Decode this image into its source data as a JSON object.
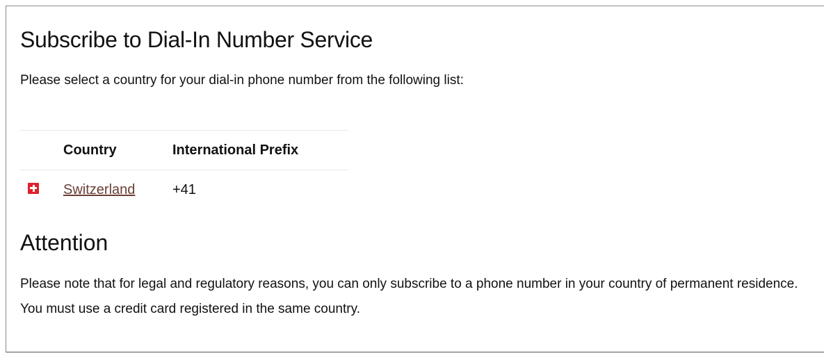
{
  "page": {
    "title": "Subscribe to Dial-In Number Service",
    "intro": "Please select a country for your dial-in phone number from the following list:"
  },
  "table": {
    "headers": {
      "flag": "",
      "country": "Country",
      "prefix": "International Prefix"
    },
    "rows": [
      {
        "flag_icon": "swiss-flag-icon",
        "country": "Switzerland",
        "prefix": "+41"
      }
    ]
  },
  "attention": {
    "heading": "Attention",
    "text": "Please note that for legal and regulatory reasons, you can only subscribe to a phone number in your country of permanent residence. You must use a credit card registered in the same country."
  },
  "colors": {
    "link": "#6a3d33",
    "flag_red": "#e0202c"
  }
}
